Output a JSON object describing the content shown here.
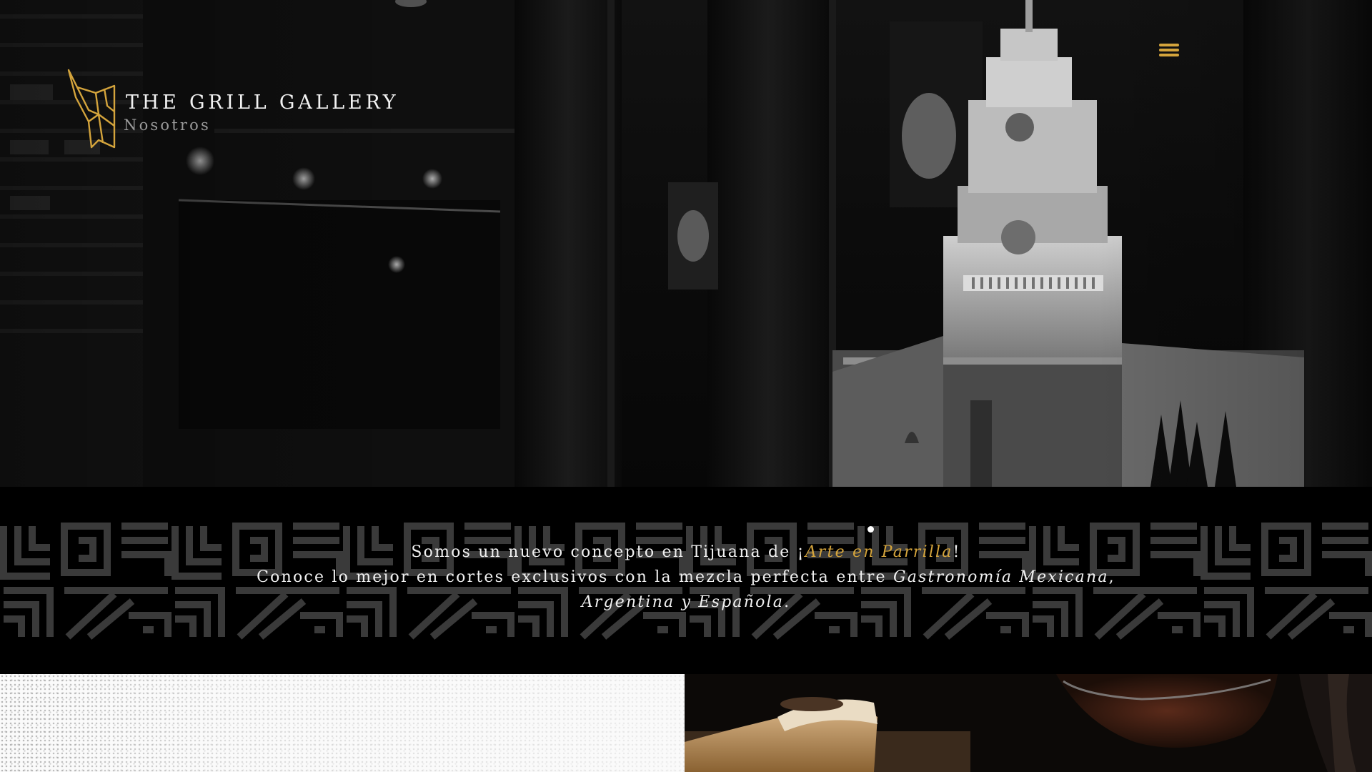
{
  "header": {
    "brand_name": "THE GRILL GALLERY",
    "brand_sub": "Nosotros",
    "logo_icon": "bull-head-icon",
    "menu_icon": "hamburger-menu-icon"
  },
  "intro": {
    "line1_prefix": "Somos un nuevo concepto en Tijuana de ¡",
    "line1_highlight": "Arte en Parrilla",
    "line1_suffix": "!",
    "line2_prefix": "Conoce lo mejor en cortes exclusivos con la mezcla perfecta entre ",
    "line2_italic": "Gastronomía Mexicana",
    "line2_suffix": ",",
    "line3_italic": "Argentina y Española",
    "line3_suffix": "."
  },
  "colors": {
    "accent_gold": "#d4a43c",
    "background": "#000000",
    "text": "#f0f0f0",
    "pattern": "#3a3a3a"
  }
}
